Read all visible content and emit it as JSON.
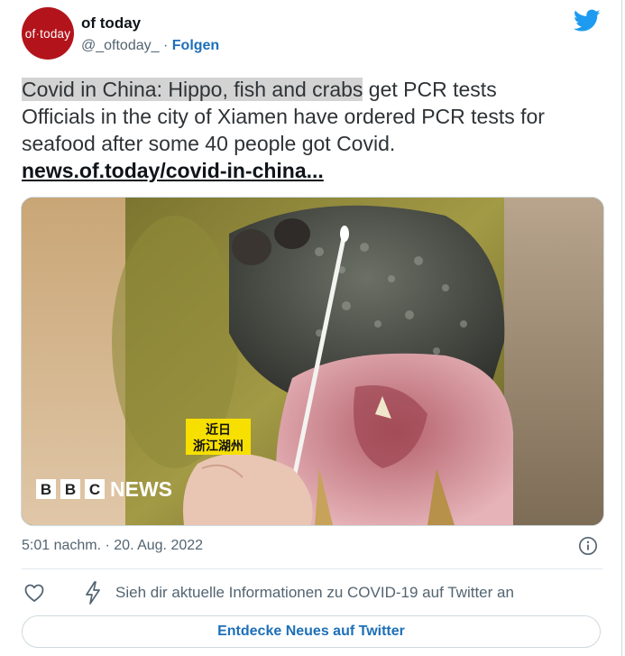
{
  "author": {
    "display_name": "of today",
    "handle": "@_oftoday_",
    "separator": "·",
    "follow_label": "Folgen",
    "avatar_text_a": "of",
    "avatar_text_dot": "·",
    "avatar_text_b": "today",
    "avatar_color": "#b3141b"
  },
  "tweet": {
    "highlighted_text": "Covid in China: Hippo, fish and crabs",
    "headline_rest": " get PCR tests",
    "body": "Officials in the city of Xiamen have ordered PCR tests for seafood after some 40 people got Covid.",
    "link_text": "news.of.today/covid-in-china..."
  },
  "media": {
    "caption_line1": "近日",
    "caption_line2": "浙江湖州",
    "logo_letters": [
      "B",
      "B",
      "C"
    ],
    "logo_word": "NEWS"
  },
  "footer": {
    "timestamp": "5:01 nachm. · 20. Aug. 2022",
    "covid_info": "Sieh dir aktuelle Informationen zu COVID-19 auf Twitter an",
    "explore_label": "Entdecke Neues auf Twitter"
  },
  "icons": {
    "brand": "twitter-bird-icon",
    "info": "info-icon",
    "like": "heart-icon",
    "covid": "lightning-icon"
  },
  "colors": {
    "link": "#1d6fb8",
    "twitter": "#1d9bf0",
    "muted": "#536471",
    "highlight": "#d3d3d3"
  }
}
